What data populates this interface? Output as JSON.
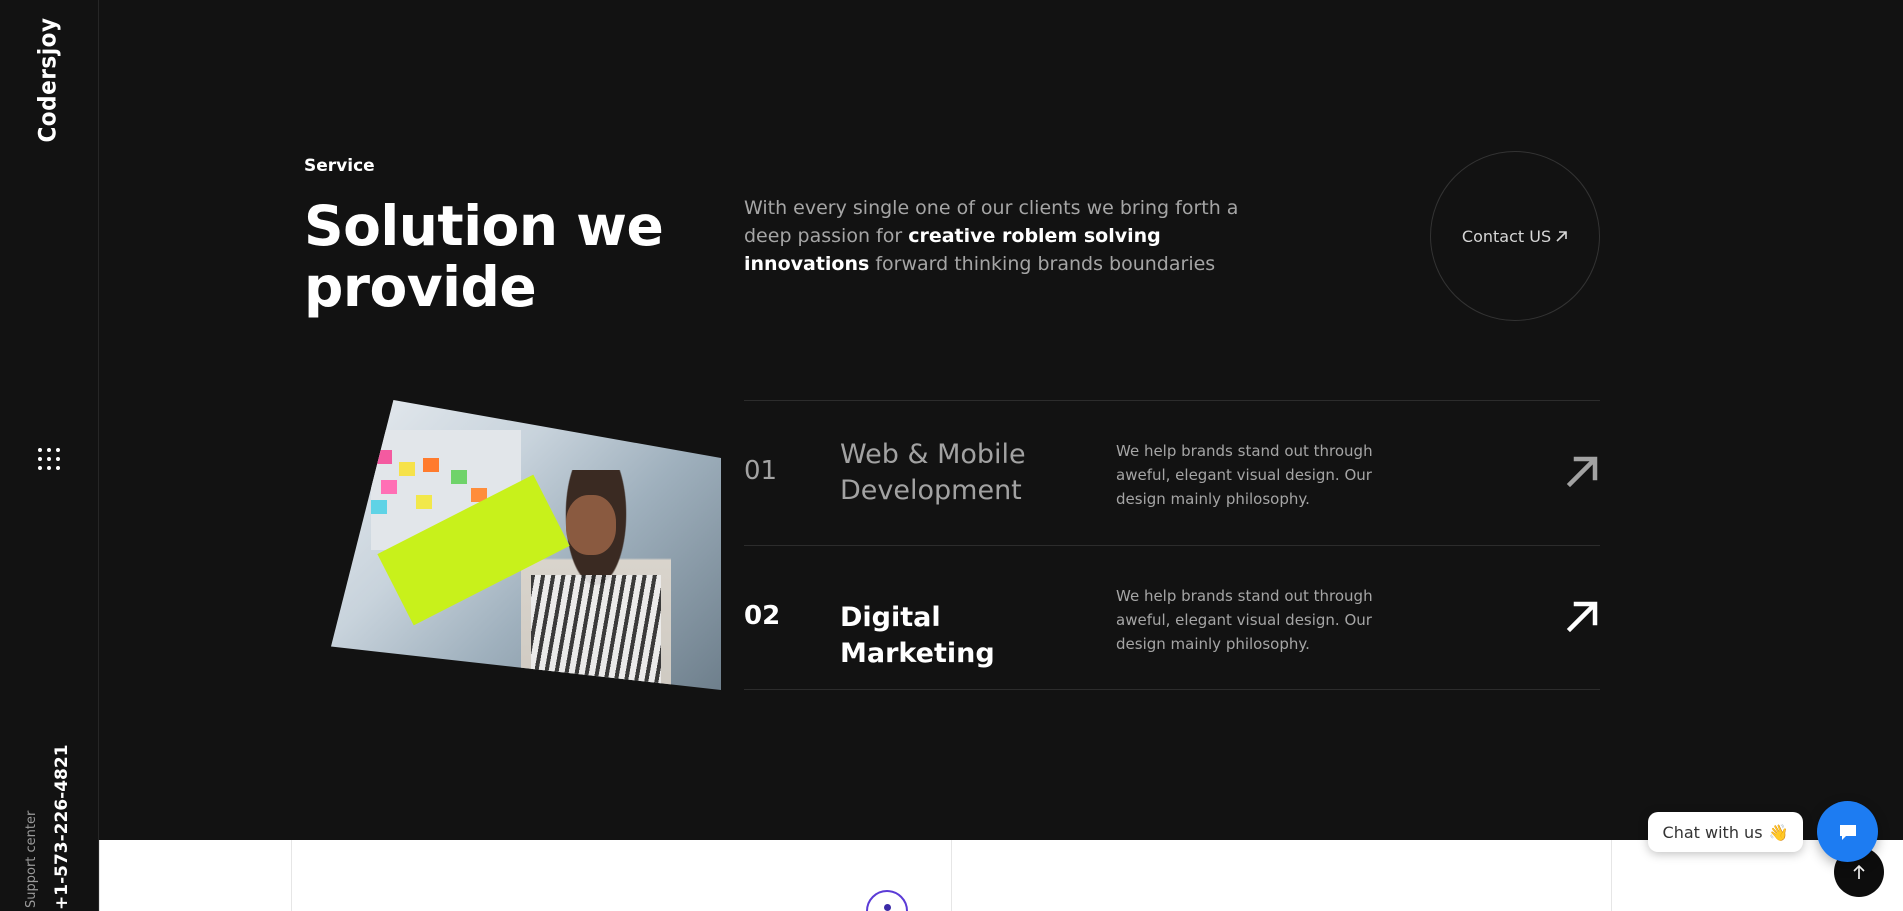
{
  "sidebar": {
    "logo": "Codersjoy",
    "menu_icon": "grid-dots-icon",
    "support_label": "Support center",
    "support_phone": "+1-573-226-4821"
  },
  "hero": {
    "eyebrow": "Service",
    "title": "Solution we provide",
    "lead_before": "With every single one of our clients we bring forth a deep passion for ",
    "lead_highlight": "creative roblem solving innovations",
    "lead_after": " forward thinking brands boundaries",
    "contact_label": "Contact US"
  },
  "services": [
    {
      "number": "01",
      "name": "Web & Mobile Development",
      "description": "We help brands stand out through aweful, elegant visual design. Our design mainly philosophy."
    },
    {
      "number": "02",
      "name": "Digital Marketing",
      "description": "We help brands stand out through aweful, elegant visual design. Our design mainly philosophy."
    }
  ],
  "chat": {
    "label": "Chat with us",
    "emoji": "👋",
    "button_icon": "chat-bubble-icon"
  },
  "colors": {
    "background": "#121212",
    "accent": "#c8f11b",
    "chat_blue": "#1d7cf2"
  }
}
